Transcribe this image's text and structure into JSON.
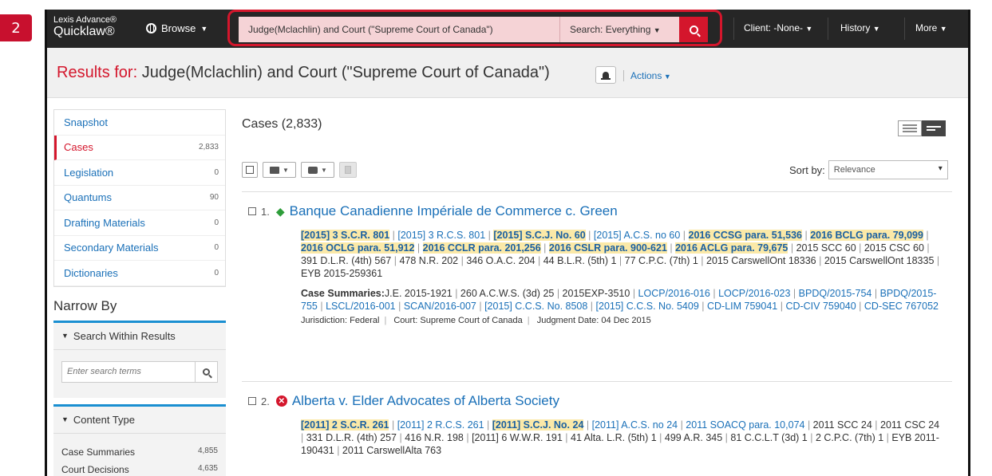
{
  "step_badge": "2",
  "app": {
    "logo_line1": "Lexis Advance®",
    "logo_line2": "Quicklaw®",
    "browse_label": "Browse",
    "search_query": "Judge(Mclachlin) and Court (\"Supreme Court of Canada\")",
    "search_scope": "Search: Everything",
    "nav": {
      "client": "Client: -None-",
      "history": "History",
      "more": "More"
    },
    "colors": {
      "topbar": "#262626",
      "accent_red": "#d4162c",
      "link_blue": "#1a70b8",
      "highlight": "#fbe9a8",
      "panel_blue": "#1a8fd1"
    }
  },
  "results": {
    "prefix": "Results for:",
    "query": " Judge(Mclachlin) and Court (\"Supreme Court of Canada\")",
    "actions_label": "Actions"
  },
  "sidebar": {
    "items": [
      {
        "label": "Snapshot",
        "count": ""
      },
      {
        "label": "Cases",
        "count": "2,833"
      },
      {
        "label": "Legislation",
        "count": "0"
      },
      {
        "label": "Quantums",
        "count": "90"
      },
      {
        "label": "Drafting Materials",
        "count": "0"
      },
      {
        "label": "Secondary Materials",
        "count": "0"
      },
      {
        "label": "Dictionaries",
        "count": "0"
      }
    ],
    "narrow_by": "Narrow By",
    "search_within": {
      "header": "Search Within Results",
      "placeholder": "Enter search terms"
    },
    "content_type": {
      "header": "Content Type",
      "rows": [
        {
          "label": "Case Summaries",
          "count": "4,855"
        },
        {
          "label": "Court Decisions",
          "count": "4,635"
        }
      ]
    }
  },
  "main": {
    "cases_title": "Cases (2,833)",
    "sort_label": "Sort by:",
    "sort_value": "Relevance",
    "results": [
      {
        "number": "1.",
        "status_icon": "green-diamond-icon",
        "title": "Banque Canadienne Impériale de Commerce c. Green",
        "cites": [
          {
            "t": "[2015] 3 S.C.R. 801",
            "k": "hl"
          },
          {
            "t": "[2015] 3 R.C.S. 801",
            "k": "link"
          },
          {
            "t": "[2015] S.C.J. No. 60",
            "k": "hl"
          },
          {
            "t": "[2015] A.C.S. no 60",
            "k": "link"
          },
          {
            "t": "2016 CCSG para. 51,536",
            "k": "hl"
          },
          {
            "t": "2016 BCLG para. 79,099",
            "k": "hl"
          },
          {
            "t": "2016 OCLG para. 51,912",
            "k": "hl"
          },
          {
            "t": "2016 CCLR para. 201,256",
            "k": "hl"
          },
          {
            "t": "2016 CSLR para. 900-621",
            "k": "hl"
          },
          {
            "t": "2016 ACLG para. 79,675",
            "k": "hl"
          },
          {
            "t": "2015 SCC 60",
            "k": "plain"
          },
          {
            "t": "2015 CSC 60",
            "k": "plain"
          },
          {
            "t": "391 D.L.R. (4th) 567",
            "k": "plain"
          },
          {
            "t": "478 N.R. 202",
            "k": "plain"
          },
          {
            "t": "346 O.A.C. 204",
            "k": "plain"
          },
          {
            "t": "44 B.L.R. (5th) 1",
            "k": "plain"
          },
          {
            "t": "77 C.P.C. (7th) 1",
            "k": "plain"
          },
          {
            "t": "2015 CarswellOnt 18336",
            "k": "plain"
          },
          {
            "t": "2015 CarswellOnt 18335",
            "k": "plain"
          },
          {
            "t": "EYB 2015-259361",
            "k": "plain"
          }
        ],
        "summaries_label": "Case Summaries:",
        "summaries": [
          {
            "t": "J.E. 2015-1921",
            "k": "plain"
          },
          {
            "t": "260 A.C.W.S. (3d) 25",
            "k": "plain"
          },
          {
            "t": "2015EXP-3510",
            "k": "plain"
          },
          {
            "t": "LOCP/2016-016",
            "k": "link"
          },
          {
            "t": "LOCP/2016-023",
            "k": "link"
          },
          {
            "t": "BPDQ/2015-754",
            "k": "link"
          },
          {
            "t": "BPDQ/2015-755",
            "k": "link"
          },
          {
            "t": "LSCL/2016-001",
            "k": "link"
          },
          {
            "t": "SCAN/2016-007",
            "k": "link"
          },
          {
            "t": "[2015] C.C.S. No. 8508",
            "k": "link"
          },
          {
            "t": "[2015] C.C.S. No. 5409",
            "k": "link"
          },
          {
            "t": "CD-LIM 759041",
            "k": "link"
          },
          {
            "t": "CD-CIV 759040",
            "k": "link"
          },
          {
            "t": "CD-SEC 767052",
            "k": "link"
          }
        ],
        "jurisdiction": "Jurisdiction: Federal",
        "court": "Court: Supreme Court of Canada",
        "judgment_date": "Judgment Date: 04 Dec 2015"
      },
      {
        "number": "2.",
        "status_icon": "red-x-circle-icon",
        "title": "Alberta v. Elder Advocates of Alberta Society",
        "cites": [
          {
            "t": "[2011] 2 S.C.R. 261",
            "k": "hl"
          },
          {
            "t": "[2011] 2 R.C.S. 261",
            "k": "link"
          },
          {
            "t": "[2011] S.C.J. No. 24",
            "k": "hl"
          },
          {
            "t": "[2011] A.C.S. no 24",
            "k": "link"
          },
          {
            "t": "2011 SOACQ para. 10,074",
            "k": "link"
          },
          {
            "t": "2011 SCC 24",
            "k": "plain"
          },
          {
            "t": "2011 CSC 24",
            "k": "plain"
          },
          {
            "t": "331 D.L.R. (4th) 257",
            "k": "plain"
          },
          {
            "t": "416 N.R. 198",
            "k": "plain"
          },
          {
            "t": "[2011] 6 W.W.R. 191",
            "k": "plain"
          },
          {
            "t": "41 Alta. L.R. (5th) 1",
            "k": "plain"
          },
          {
            "t": "499 A.R. 345",
            "k": "plain"
          },
          {
            "t": "81 C.C.L.T (3d) 1",
            "k": "plain"
          },
          {
            "t": "2 C.P.C. (7th) 1",
            "k": "plain"
          },
          {
            "t": "EYB 2011-190431",
            "k": "plain"
          },
          {
            "t": "2011 CarswellAlta 763",
            "k": "plain"
          }
        ]
      }
    ]
  }
}
